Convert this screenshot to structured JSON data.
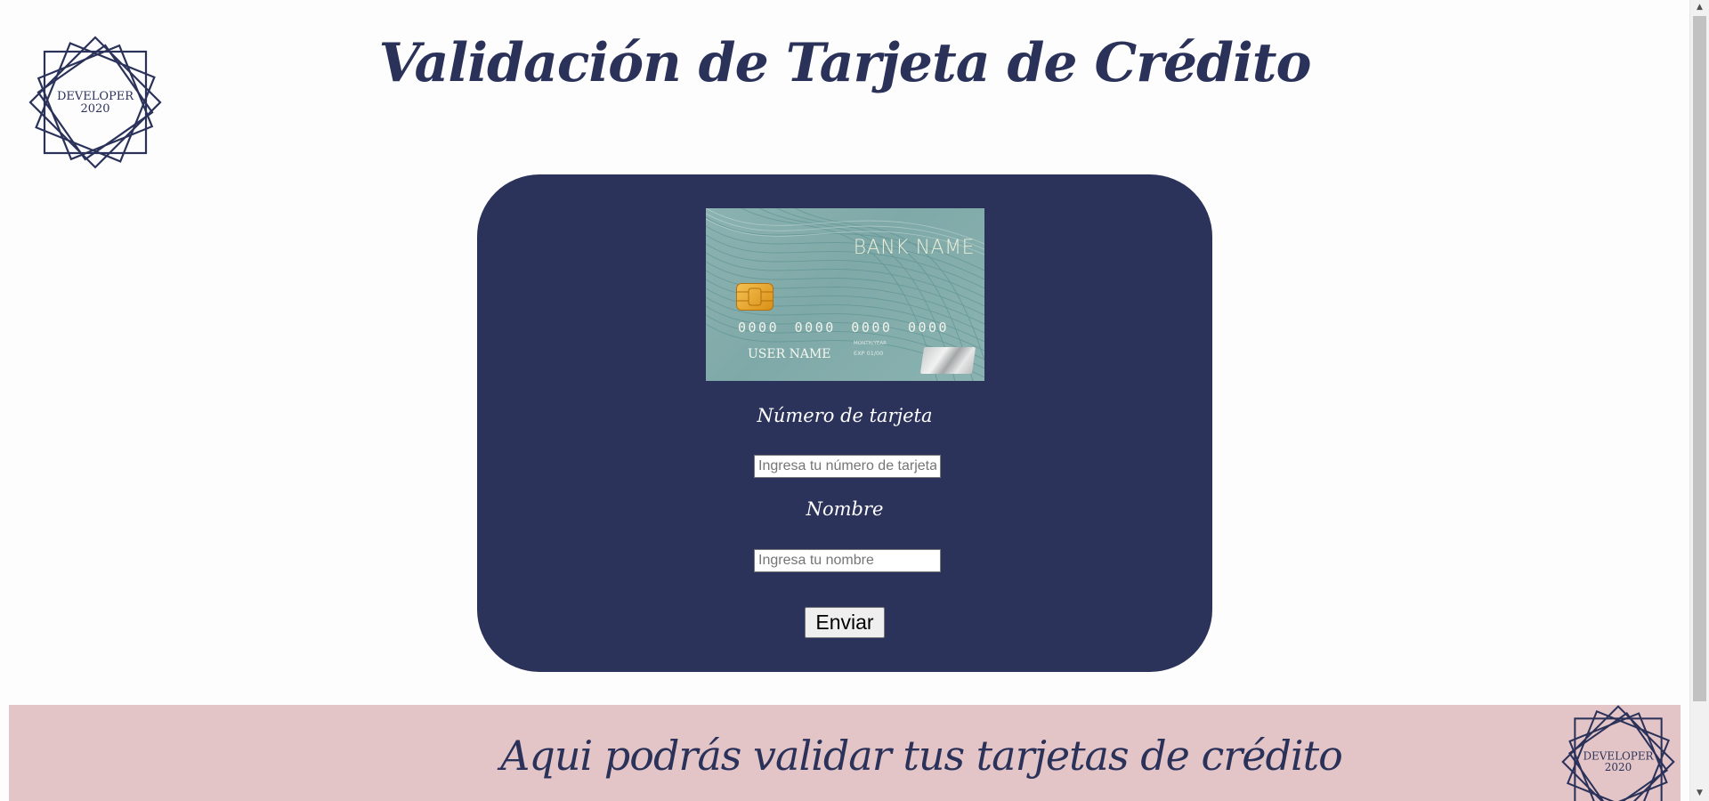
{
  "header": {
    "title": "Validación de Tarjeta de Crédito",
    "logo_text_line1": "DEVELOPER",
    "logo_text_line2": "2020"
  },
  "card_preview": {
    "bank_name": "BANK NAME",
    "number": "0000 0000 0000 0000",
    "user_name": "USER NAME",
    "month_year_label": "MONTH/YEAR",
    "exp_label": "EXP",
    "exp_value": "01/00"
  },
  "form": {
    "number_label": "Número de tarjeta",
    "number_placeholder": "Ingresa tu número de tarjeta",
    "name_label": "Nombre",
    "name_placeholder": "Ingresa tu nombre",
    "submit_label": "Enviar"
  },
  "banner": {
    "text": "Aqui podrás validar tus tarjetas de crédito",
    "logo_text_line1": "DEVELOPER",
    "logo_text_line2": "2020"
  },
  "colors": {
    "navy": "#2c335b",
    "pink_banner": "#e4c5c7",
    "card_teal": "#8bb2b1"
  }
}
